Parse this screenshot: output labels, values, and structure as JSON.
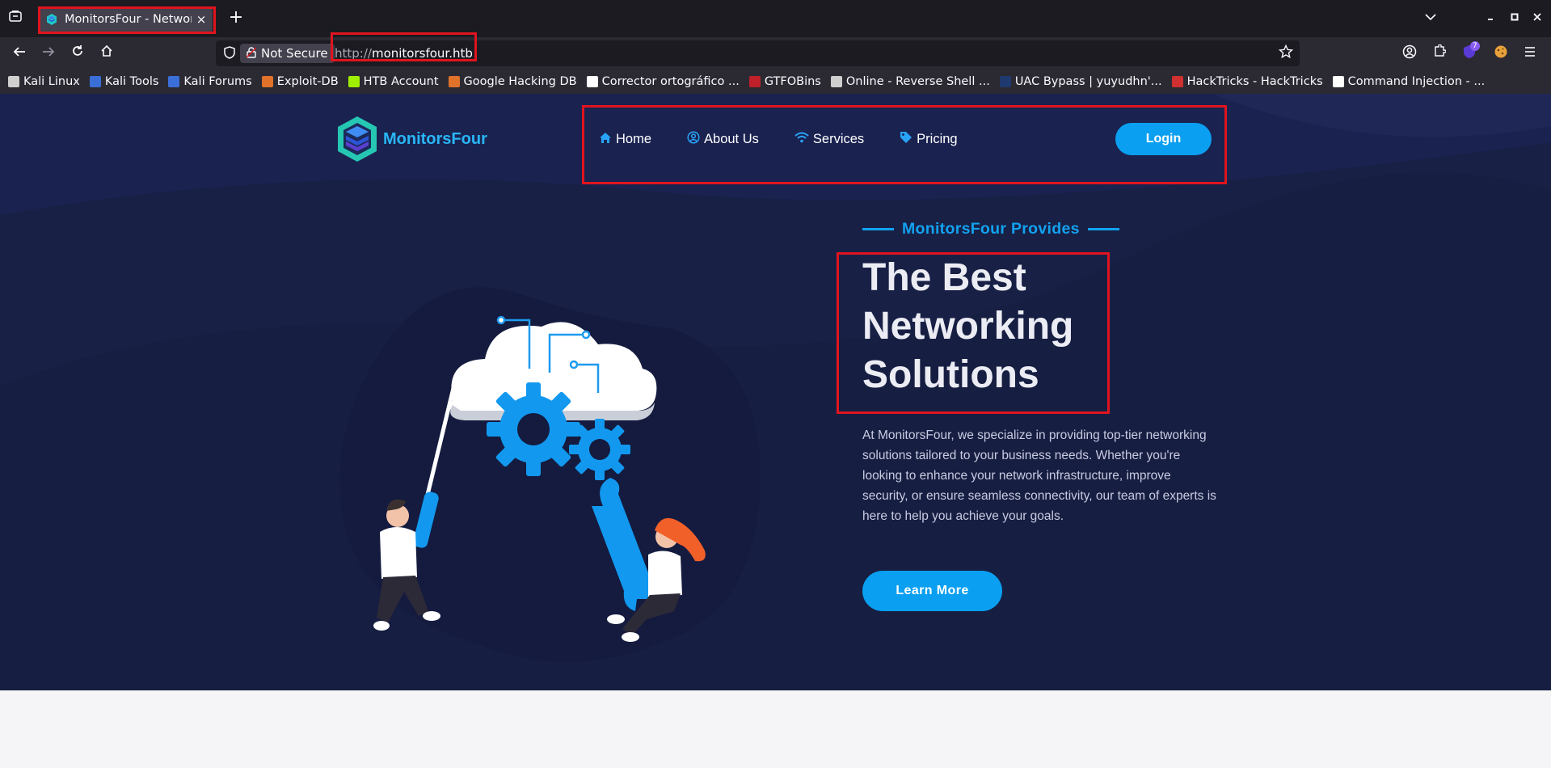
{
  "browser": {
    "tab": {
      "title": "MonitorsFour - Networking Solutions",
      "close_label": "×"
    },
    "new_tab_label": "+",
    "url": {
      "security_label": "Not Secure",
      "scheme": "http://",
      "host": "monitorsfour.htb"
    },
    "extension_badge": "7",
    "bookmarks": [
      {
        "label": "Kali Linux",
        "color": "#d0d0d0"
      },
      {
        "label": "Kali Tools",
        "color": "#3b6fd8"
      },
      {
        "label": "Kali Forums",
        "color": "#3b6fd8"
      },
      {
        "label": "Exploit-DB",
        "color": "#e0722a"
      },
      {
        "label": "HTB Account",
        "color": "#9fef00"
      },
      {
        "label": "Google Hacking DB",
        "color": "#e0722a"
      },
      {
        "label": "Corrector ortográfico ...",
        "color": "#ffffff"
      },
      {
        "label": "GTFOBins",
        "color": "#c0202a"
      },
      {
        "label": "Online - Reverse Shell ...",
        "color": "#cfcfcf"
      },
      {
        "label": "UAC Bypass | yuyudhn'...",
        "color": "#1e3a6e"
      },
      {
        "label": "HackTricks - HackTricks",
        "color": "#d03030"
      },
      {
        "label": "Command Injection - ...",
        "color": "#ffffff"
      }
    ]
  },
  "site": {
    "logo_text": "MonitorsFour",
    "nav": [
      {
        "label": "Home",
        "icon": "home-icon"
      },
      {
        "label": "About Us",
        "icon": "user-circle-icon"
      },
      {
        "label": "Services",
        "icon": "wifi-icon"
      },
      {
        "label": "Pricing",
        "icon": "tag-icon"
      }
    ],
    "login_label": "Login",
    "hero": {
      "kicker": "MonitorsFour Provides",
      "title_lines": [
        "The Best",
        "Networking",
        "Solutions"
      ],
      "description": "At MonitorsFour, we specialize in providing top-tier networking solutions tailored to your business needs. Whether you're looking to enhance your network infrastructure, improve security, or ensure seamless connectivity, our team of experts is here to help you achieve your goals.",
      "cta_label": "Learn More"
    },
    "colors": {
      "accent": "#0a9ff0",
      "background": "#182046",
      "highlight": "#e0141e"
    }
  }
}
